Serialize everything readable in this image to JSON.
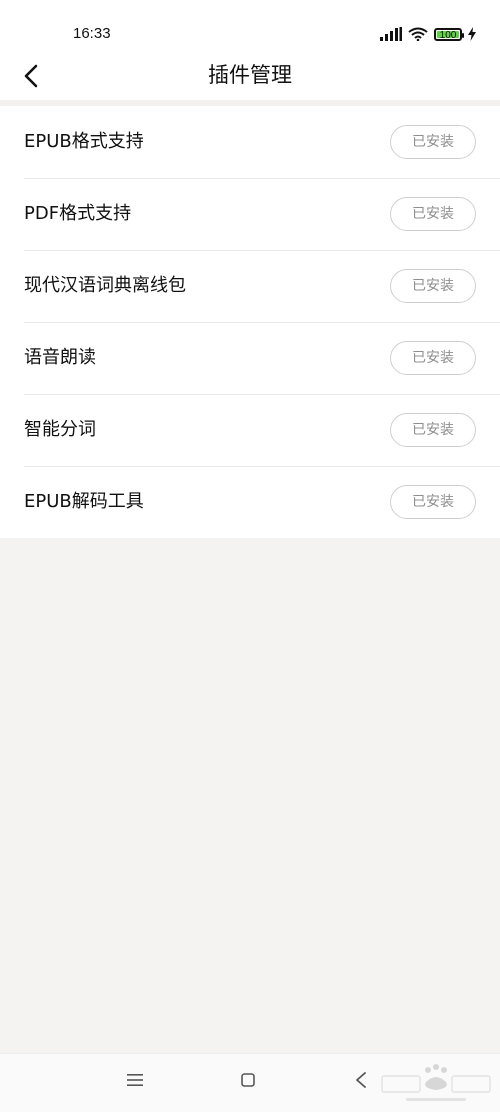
{
  "status_bar": {
    "time": "16:33",
    "battery": "100",
    "icons": [
      "signal-icon",
      "wifi-icon",
      "battery-icon",
      "charging-icon"
    ]
  },
  "header": {
    "title": "插件管理",
    "back_icon": "back-chevron-icon"
  },
  "plugins": [
    {
      "name": "EPUB格式支持",
      "status": "已安装"
    },
    {
      "name": "PDF格式支持",
      "status": "已安装"
    },
    {
      "name": "现代汉语词典离线包",
      "status": "已安装"
    },
    {
      "name": "语音朗读",
      "status": "已安装"
    },
    {
      "name": "智能分词",
      "status": "已安装"
    },
    {
      "name": "EPUB解码工具",
      "status": "已安装"
    }
  ],
  "nav_bar": {
    "icons": [
      "menu-icon",
      "home-icon",
      "back-icon"
    ]
  },
  "colors": {
    "page_background": "#f4f3f1",
    "card_background": "#ffffff",
    "button_text": "#8f8f8f",
    "button_border": "#cfcfcf",
    "battery_fill": "#62d14a"
  }
}
